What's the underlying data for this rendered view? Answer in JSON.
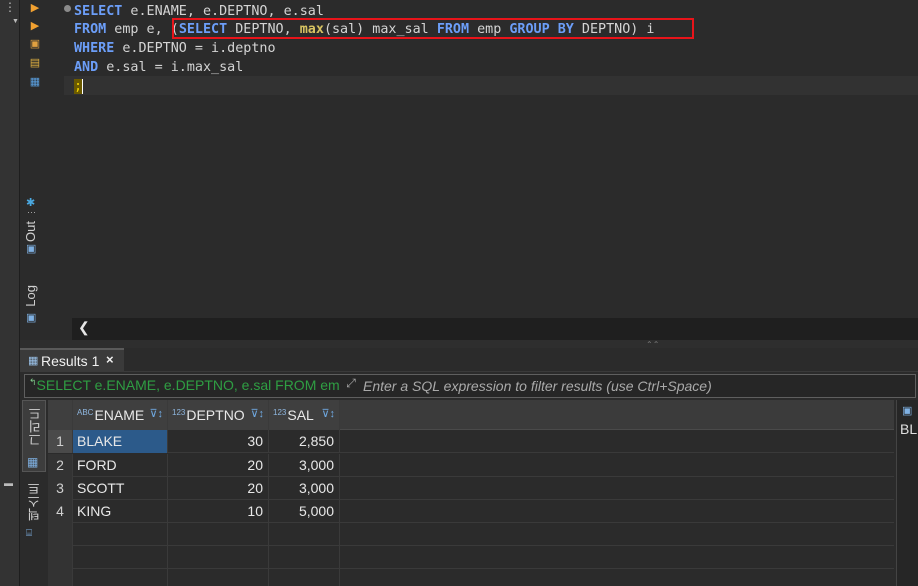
{
  "editor": {
    "lines": [
      {
        "tokens": [
          {
            "t": "SELECT",
            "c": "kw"
          },
          {
            "t": " e.ENAME, e.DEPTNO, e.sal",
            "c": ""
          }
        ]
      },
      {
        "tokens": [
          {
            "t": "FROM",
            "c": "kw"
          },
          {
            "t": " emp e, ",
            "c": ""
          },
          {
            "t": "(",
            "c": ""
          },
          {
            "t": "SELECT",
            "c": "kw"
          },
          {
            "t": " DEPTNO, ",
            "c": ""
          },
          {
            "t": "max",
            "c": "fn"
          },
          {
            "t": "(sal) max_sal ",
            "c": ""
          },
          {
            "t": "FROM",
            "c": "kw"
          },
          {
            "t": " emp ",
            "c": ""
          },
          {
            "t": "GROUP BY",
            "c": "kw"
          },
          {
            "t": " DEPTNO)",
            "c": ""
          },
          {
            "t": " i",
            "c": ""
          }
        ]
      },
      {
        "tokens": [
          {
            "t": "WHERE",
            "c": "kw"
          },
          {
            "t": " e.DEPTNO = i.deptno",
            "c": ""
          }
        ]
      },
      {
        "tokens": [
          {
            "t": "AND",
            "c": "kw"
          },
          {
            "t": " e.sal = i.max_sal",
            "c": ""
          }
        ]
      },
      {
        "tokens": [
          {
            "t": ";",
            "c": "semi"
          }
        ]
      }
    ],
    "highlight_color": "#e8141a"
  },
  "side_tabs": {
    "out": "Out",
    "log": "Log"
  },
  "results": {
    "tab_label": "Results 1",
    "tab_close": "×",
    "filter_query": "SELECT e.ENAME, e.DEPTNO, e.sal FROM em",
    "filter_placeholder": "Enter a SQL expression to filter results (use Ctrl+Space)",
    "grid_tab": "그리드",
    "text_tab": "텍스트",
    "right_panel_label": "BL",
    "columns": [
      {
        "name": "ENAME",
        "type": "ABC"
      },
      {
        "name": "DEPTNO",
        "type": "123"
      },
      {
        "name": "SAL",
        "type": "123"
      }
    ],
    "rows": [
      {
        "n": "1",
        "ENAME": "BLAKE",
        "DEPTNO": "30",
        "SAL": "2,850"
      },
      {
        "n": "2",
        "ENAME": "FORD",
        "DEPTNO": "20",
        "SAL": "3,000"
      },
      {
        "n": "3",
        "ENAME": "SCOTT",
        "DEPTNO": "20",
        "SAL": "3,000"
      },
      {
        "n": "4",
        "ENAME": "KING",
        "DEPTNO": "10",
        "SAL": "5,000"
      }
    ],
    "selected_row": 0
  },
  "colors": {
    "keyword": "#6c9ef8",
    "function": "#d6c261",
    "selection": "#2c5a8a",
    "filter_text": "#2f9e43"
  }
}
